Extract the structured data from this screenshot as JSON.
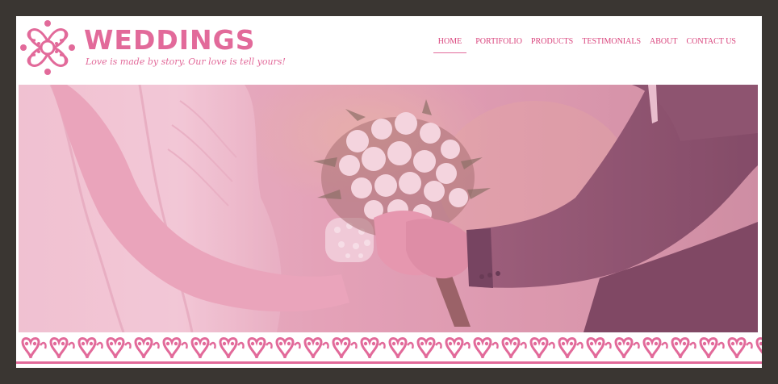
{
  "brand": {
    "title": "WEDDINGS",
    "tagline": "Love is made by story. Our love is tell yours!",
    "accent_color": "#e26a9a",
    "logo_icon": "ornament-flower-icon"
  },
  "nav": {
    "items": [
      {
        "label": "HOME",
        "active": true
      },
      {
        "label": "PORTIFOLIO",
        "active": false
      },
      {
        "label": "PRODUCTS",
        "active": false
      },
      {
        "label": "TESTIMONIALS",
        "active": false
      },
      {
        "label": "ABOUT",
        "active": false
      },
      {
        "label": "CONTACT US",
        "active": false
      }
    ]
  },
  "hero": {
    "image": "bride-groom-holding-bouquet-photo",
    "tint_color": "#e88bb0"
  },
  "footer_border": {
    "pattern": "pink-heart-scroll-ornament"
  }
}
